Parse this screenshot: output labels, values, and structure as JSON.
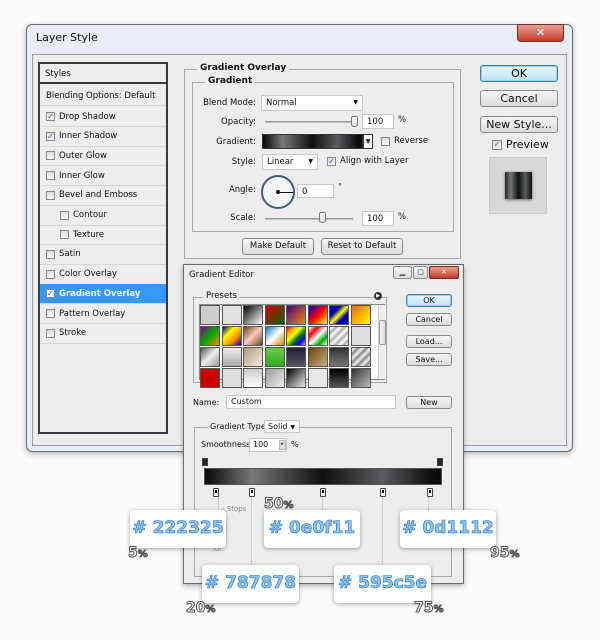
{
  "layer_style": {
    "title": "Layer Style",
    "close_glyph": "✕",
    "styles_header": "Styles",
    "blending_options": "Blending Options: Default",
    "items": [
      {
        "label": "Drop Shadow",
        "checked": true,
        "indent": false,
        "selected": false
      },
      {
        "label": "Inner Shadow",
        "checked": true,
        "indent": false,
        "selected": false
      },
      {
        "label": "Outer Glow",
        "checked": false,
        "indent": false,
        "selected": false
      },
      {
        "label": "Inner Glow",
        "checked": false,
        "indent": false,
        "selected": false
      },
      {
        "label": "Bevel and Emboss",
        "checked": false,
        "indent": false,
        "selected": false
      },
      {
        "label": "Contour",
        "checked": false,
        "indent": true,
        "selected": false
      },
      {
        "label": "Texture",
        "checked": false,
        "indent": true,
        "selected": false
      },
      {
        "label": "Satin",
        "checked": false,
        "indent": false,
        "selected": false
      },
      {
        "label": "Color Overlay",
        "checked": false,
        "indent": false,
        "selected": false
      },
      {
        "label": "Gradient Overlay",
        "checked": true,
        "indent": false,
        "selected": true
      },
      {
        "label": "Pattern Overlay",
        "checked": false,
        "indent": false,
        "selected": false
      },
      {
        "label": "Stroke",
        "checked": false,
        "indent": false,
        "selected": false
      }
    ],
    "panel": {
      "section_title": "Gradient Overlay",
      "group_title": "Gradient",
      "blend_mode_label": "Blend Mode:",
      "blend_mode_value": "Normal",
      "opacity_label": "Opacity:",
      "opacity_value": "100",
      "opacity_percent": 100,
      "percent_sign": "%",
      "gradient_label": "Gradient:",
      "reverse_label": "Reverse",
      "reverse_checked": false,
      "style_label": "Style:",
      "style_value": "Linear",
      "align_label": "Align with Layer",
      "align_checked": true,
      "angle_label": "Angle:",
      "angle_value": "0",
      "degree_sign": "°",
      "scale_label": "Scale:",
      "scale_value": "100",
      "scale_percent": 100,
      "make_default": "Make Default",
      "reset_default": "Reset to Default"
    },
    "buttons": {
      "ok": "OK",
      "cancel": "Cancel",
      "new_style": "New Style...",
      "preview_label": "Preview",
      "preview_checked": true
    }
  },
  "gradient_editor": {
    "title": "Gradient Editor",
    "presets_label": "Presets",
    "ok": "OK",
    "cancel": "Cancel",
    "load": "Load...",
    "save": "Save...",
    "name_label": "Name:",
    "name_value": "Custom",
    "new_button": "New",
    "gradient_type_label": "Gradient Type:",
    "gradient_type_value": "Solid",
    "smoothness_label": "Smoothness:",
    "smoothness_value": "100",
    "percent_sign": "%",
    "color_stops": [
      {
        "position": 5,
        "color": "#222325"
      },
      {
        "position": 20,
        "color": "#787878"
      },
      {
        "position": 50,
        "color": "#0e0f11"
      },
      {
        "position": 75,
        "color": "#595c5e"
      },
      {
        "position": 95,
        "color": "#0d1112"
      }
    ],
    "partial_labels": {
      "opacity": "city:",
      "color": "lor:"
    }
  },
  "callouts": [
    {
      "hex": "# 222325",
      "percent": "5",
      "unit": "%"
    },
    {
      "hex": "# 787878",
      "percent": "20",
      "unit": "%"
    },
    {
      "hex": "# 0e0f11",
      "percent": "50",
      "unit": "%"
    },
    {
      "hex": "# 595c5e",
      "percent": "75",
      "unit": "%"
    },
    {
      "hex": "# 0d1112",
      "percent": "95",
      "unit": "%"
    }
  ]
}
